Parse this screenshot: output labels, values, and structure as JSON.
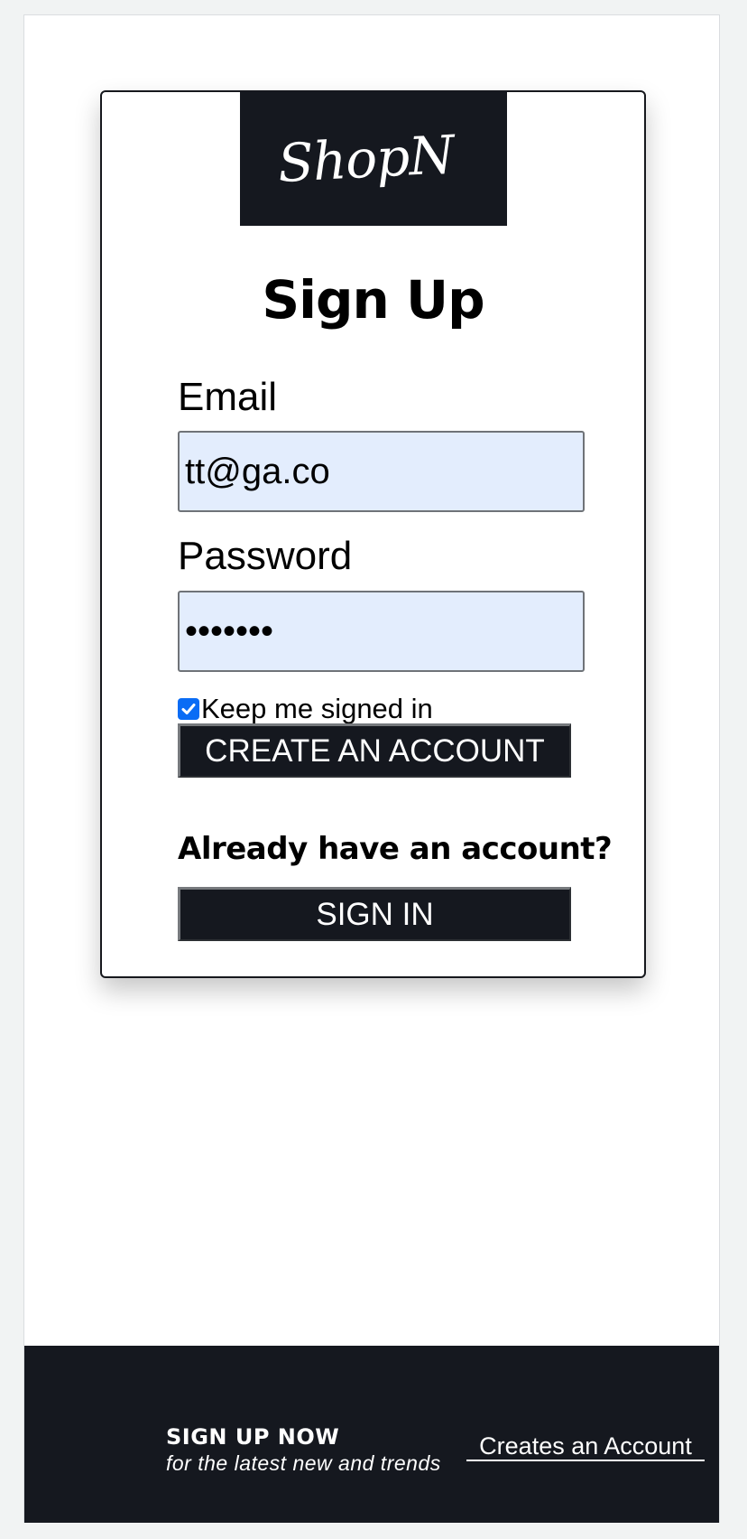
{
  "brand": {
    "logo_text": "ShopN"
  },
  "form": {
    "title": "Sign Up",
    "email_label": "Email",
    "email_value": "tt@ga.co",
    "password_label": "Password",
    "password_value": "•••••••",
    "keep_signed_in_label": "Keep me signed in",
    "keep_signed_in_checked": true,
    "create_button_label": "CREATE AN ACCOUNT",
    "already_text": "Already have an account?",
    "signin_button_label": "SIGN IN"
  },
  "footer": {
    "title": "SIGN UP NOW",
    "subtitle": "for the latest new and trends",
    "link_label": "Creates an Account"
  },
  "colors": {
    "dark": "#15181f",
    "input_bg": "#e3edfd",
    "checkbox_accent": "#0a6cf5"
  },
  "icons": {
    "checkbox": "checkmark-icon"
  }
}
